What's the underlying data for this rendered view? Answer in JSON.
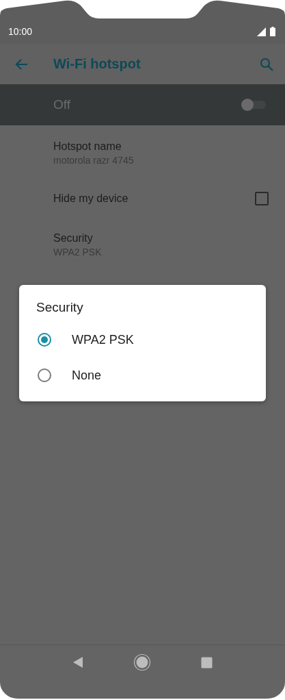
{
  "status_bar": {
    "time": "10:00"
  },
  "app_bar": {
    "title": "Wi-Fi hotspot"
  },
  "master_switch": {
    "label": "Off",
    "on": false
  },
  "settings": [
    {
      "kind": "text",
      "title": "Hotspot name",
      "summary": "motorola razr 4745"
    },
    {
      "kind": "checkbox",
      "title": "Hide my device",
      "checked": false
    },
    {
      "kind": "text",
      "title": "Security",
      "summary": "WPA2 PSK"
    }
  ],
  "dialog": {
    "title": "Security",
    "options": [
      {
        "label": "WPA2 PSK",
        "selected": true
      },
      {
        "label": "None",
        "selected": false
      }
    ]
  }
}
